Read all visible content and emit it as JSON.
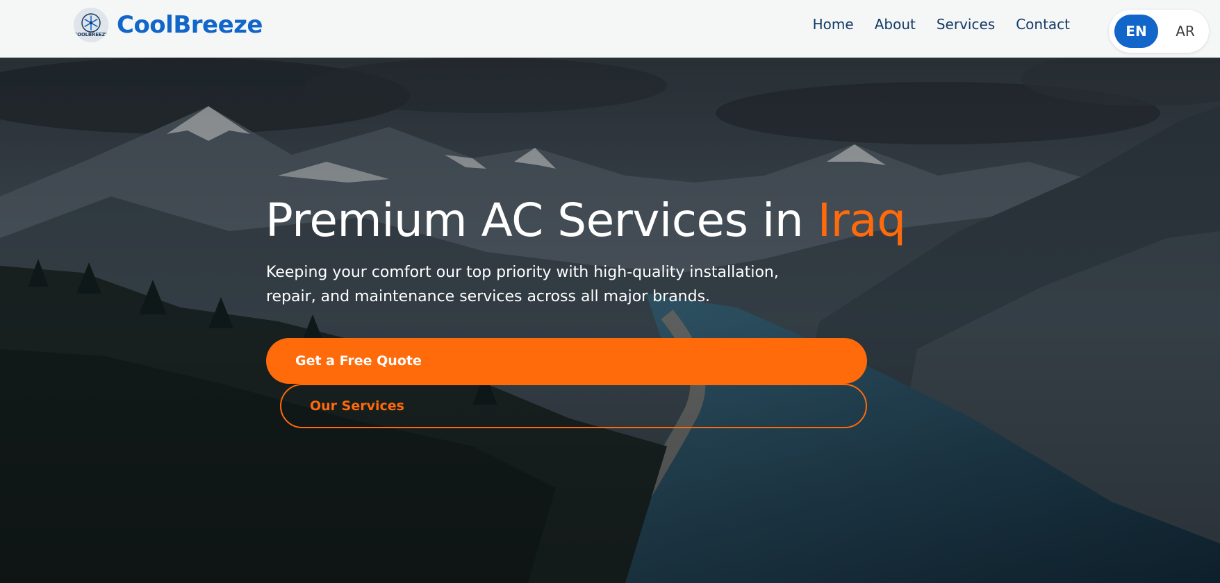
{
  "header": {
    "logo_text": "COOLBREEZE",
    "brand_name": "CoolBreeze",
    "nav": [
      {
        "label": "Home"
      },
      {
        "label": "About"
      },
      {
        "label": "Services"
      },
      {
        "label": "Contact"
      }
    ],
    "languages": {
      "active": "EN",
      "inactive": "AR"
    }
  },
  "hero": {
    "title_main": "Premium AC Services in ",
    "title_accent": "Iraq",
    "subtitle": "Keeping your comfort our top priority with high-quality installation, repair, and maintenance services across all major brands.",
    "primary_cta": "Get a Free Quote",
    "secondary_cta": "Our Services",
    "background_image": "mountain-lake-landscape"
  },
  "colors": {
    "brand_blue": "#1266c9",
    "nav_text": "#123a66",
    "accent_orange": "#ff6a0a",
    "header_bg": "#f5f6f6"
  }
}
